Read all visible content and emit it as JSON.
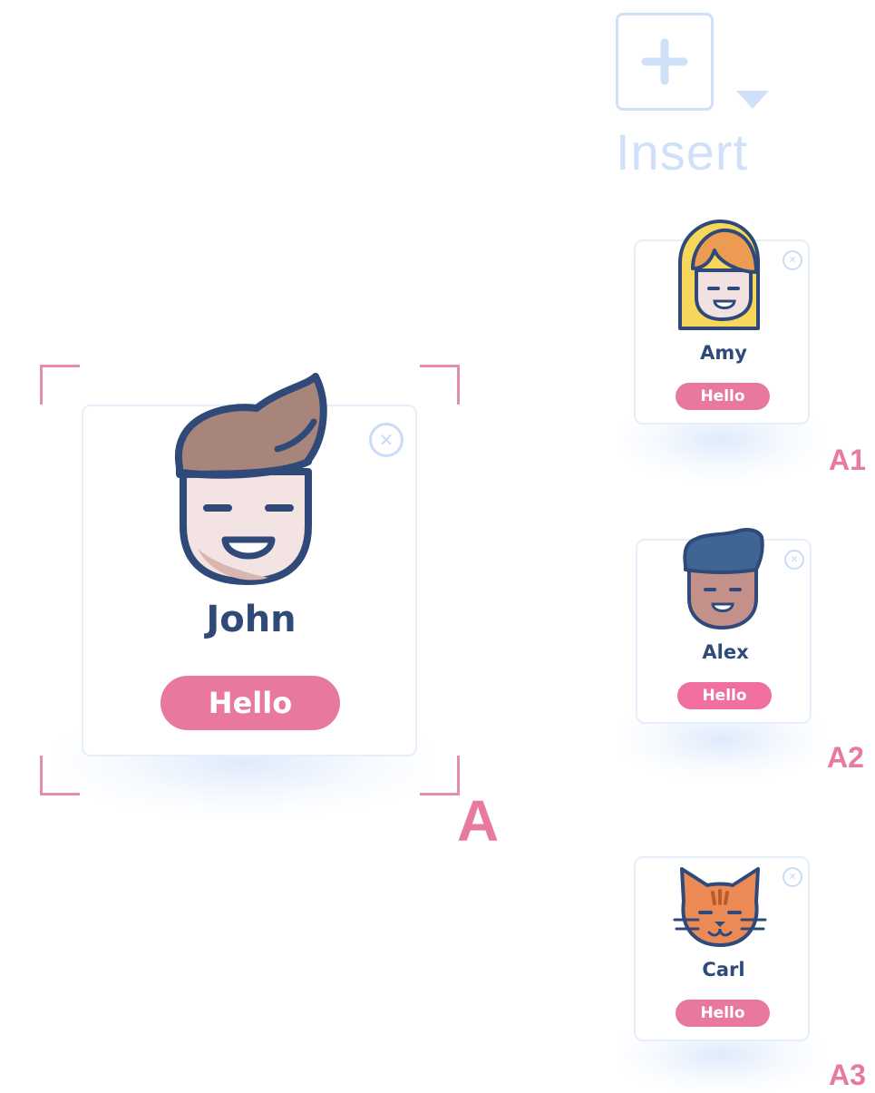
{
  "insert": {
    "label": "Insert",
    "icon": "plus-icon",
    "menu_icon": "caret-down-icon"
  },
  "selected": {
    "name": "John",
    "button_label": "Hello",
    "tag": "A",
    "avatar_icon": "man-avatar-icon",
    "close_icon": "close-icon"
  },
  "variants": [
    {
      "name": "Amy",
      "button_label": "Hello",
      "tag": "A1",
      "avatar_icon": "woman-avatar-icon"
    },
    {
      "name": "Alex",
      "button_label": "Hello",
      "tag": "A2",
      "avatar_icon": "man-avatar-icon"
    },
    {
      "name": "Carl",
      "button_label": "Hello",
      "tag": "A3",
      "avatar_icon": "cat-avatar-icon"
    }
  ],
  "colors": {
    "accent_pink": "#e8789f",
    "text_navy": "#2f4a78",
    "muted_blue": "#cfe0f8"
  }
}
